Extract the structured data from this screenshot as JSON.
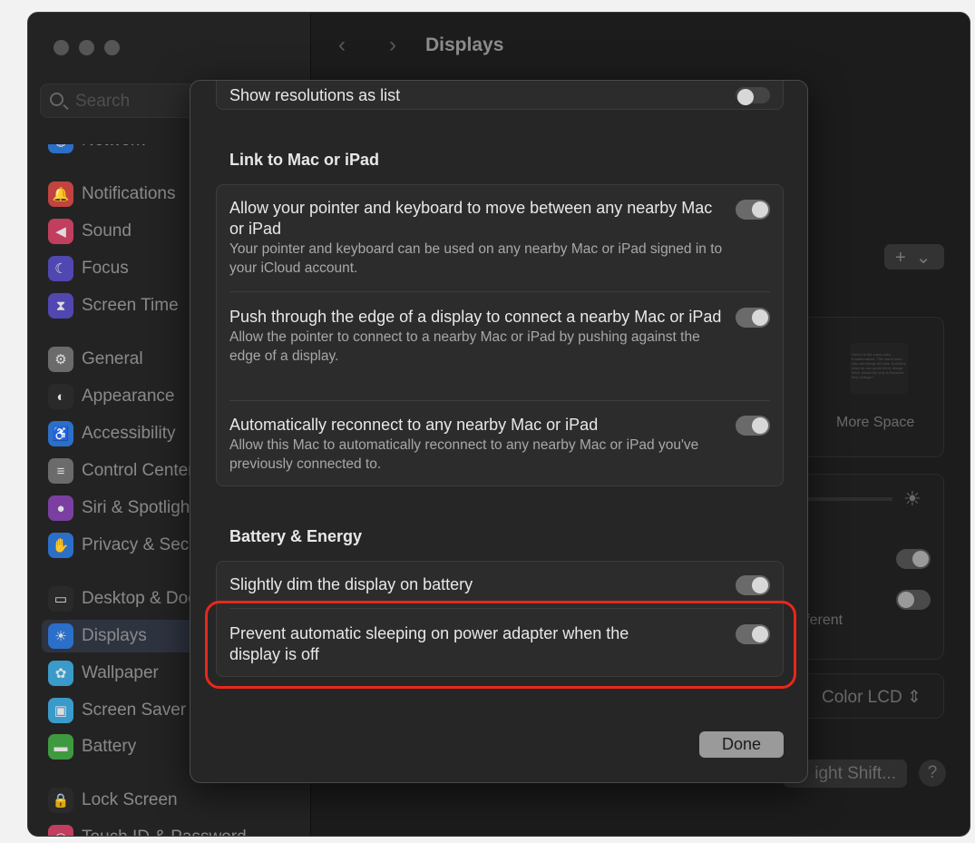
{
  "window": {
    "title": "Displays",
    "search_placeholder": "Search"
  },
  "sidebar": {
    "items": [
      {
        "label": "Network",
        "color": "#2b6fc9",
        "glyph": "◍"
      },
      {
        "label": "Notifications",
        "color": "#c2433f",
        "glyph": "🔔"
      },
      {
        "label": "Sound",
        "color": "#c23e5e",
        "glyph": "◀"
      },
      {
        "label": "Focus",
        "color": "#5147b0",
        "glyph": "☾"
      },
      {
        "label": "Screen Time",
        "color": "#5147b0",
        "glyph": "⧗"
      },
      {
        "label": "General",
        "color": "#6b6b6b",
        "glyph": "⚙"
      },
      {
        "label": "Appearance",
        "color": "#2a2a2a",
        "glyph": "◐"
      },
      {
        "label": "Accessibility",
        "color": "#2b6fc9",
        "glyph": "♿"
      },
      {
        "label": "Control Center",
        "color": "#6b6b6b",
        "glyph": "≡"
      },
      {
        "label": "Siri & Spotlight",
        "color": "#7a3fa0",
        "glyph": "●"
      },
      {
        "label": "Privacy & Security",
        "color": "#2b6fc9",
        "glyph": "✋"
      },
      {
        "label": "Desktop & Dock",
        "color": "#2a2a2a",
        "glyph": "▭"
      },
      {
        "label": "Displays",
        "color": "#2b6fc9",
        "glyph": "☀",
        "selected": true
      },
      {
        "label": "Wallpaper",
        "color": "#3a9ac9",
        "glyph": "✿"
      },
      {
        "label": "Screen Saver",
        "color": "#3a9ac9",
        "glyph": "▣"
      },
      {
        "label": "Battery",
        "color": "#3f9a3f",
        "glyph": "▬"
      },
      {
        "label": "Lock Screen",
        "color": "#2a2a2a",
        "glyph": "🔒"
      },
      {
        "label": "Touch ID & Password",
        "color": "#c23e5e",
        "glyph": "◎"
      }
    ]
  },
  "background": {
    "more_space": "More Space",
    "preview_text": "Here's to the crazy ones troublemakers. The round ones who see things dif rules. And they have no can quote them, disagr them. About the only th Because they change t",
    "different_fragment": "fferent",
    "color_profile": "Color LCD",
    "night_shift": "ight Shift...",
    "help": "?",
    "add": "+"
  },
  "modal": {
    "top_row": {
      "label": "Show resolutions as list",
      "on": false
    },
    "sections": [
      {
        "heading": "Link to Mac or iPad",
        "rows": [
          {
            "label": "Allow your pointer and keyboard to move between any nearby Mac or iPad",
            "sub": "Your pointer and keyboard can be used on any nearby Mac or iPad signed in to your iCloud account.",
            "on": true
          },
          {
            "label": "Push through the edge of a display to connect a nearby Mac or iPad",
            "sub": "Allow the pointer to connect to a nearby Mac or iPad by pushing against the edge of a display.",
            "on": true
          },
          {
            "label": "Automatically reconnect to any nearby Mac or iPad",
            "sub": "Allow this Mac to automatically reconnect to any nearby Mac or iPad you've previously connected to.",
            "on": true
          }
        ]
      },
      {
        "heading": "Battery & Energy",
        "rows": [
          {
            "label": "Slightly dim the display on battery",
            "on": true
          },
          {
            "label": "Prevent automatic sleeping on power adapter when the display is off",
            "on": true
          }
        ]
      }
    ],
    "done": "Done"
  },
  "highlight_color": "#e8271c"
}
